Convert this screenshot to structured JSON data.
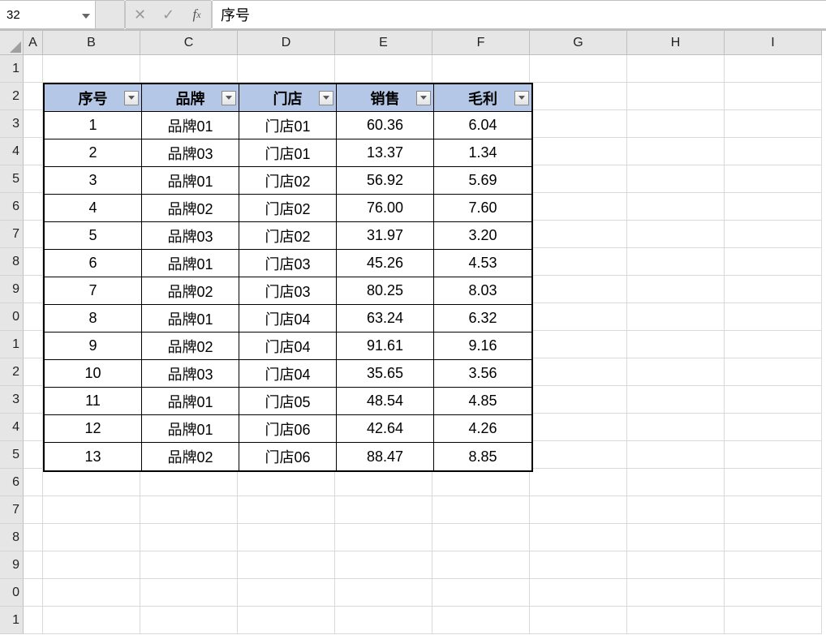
{
  "formulaBar": {
    "nameBox": "32",
    "formula": "序号"
  },
  "columnHeaders": [
    "A",
    "B",
    "C",
    "D",
    "E",
    "F",
    "G",
    "H",
    "I"
  ],
  "rowHeaders": [
    "1",
    "2",
    "3",
    "4",
    "5",
    "6",
    "7",
    "8",
    "9",
    "0",
    "1",
    "2",
    "3",
    "4",
    "5",
    "6",
    "7",
    "8",
    "9",
    "0",
    "1"
  ],
  "table": {
    "headers": [
      "序号",
      "品牌",
      "门店",
      "销售",
      "毛利"
    ],
    "rows": [
      [
        "1",
        "品牌01",
        "门店01",
        "60.36",
        "6.04"
      ],
      [
        "2",
        "品牌03",
        "门店01",
        "13.37",
        "1.34"
      ],
      [
        "3",
        "品牌01",
        "门店02",
        "56.92",
        "5.69"
      ],
      [
        "4",
        "品牌02",
        "门店02",
        "76.00",
        "7.60"
      ],
      [
        "5",
        "品牌03",
        "门店02",
        "31.97",
        "3.20"
      ],
      [
        "6",
        "品牌01",
        "门店03",
        "45.26",
        "4.53"
      ],
      [
        "7",
        "品牌02",
        "门店03",
        "80.25",
        "8.03"
      ],
      [
        "8",
        "品牌01",
        "门店04",
        "63.24",
        "6.32"
      ],
      [
        "9",
        "品牌02",
        "门店04",
        "91.61",
        "9.16"
      ],
      [
        "10",
        "品牌03",
        "门店04",
        "35.65",
        "3.56"
      ],
      [
        "11",
        "品牌01",
        "门店05",
        "48.54",
        "4.85"
      ],
      [
        "12",
        "品牌01",
        "门店06",
        "42.64",
        "4.26"
      ],
      [
        "13",
        "品牌02",
        "门店06",
        "88.47",
        "8.85"
      ]
    ]
  }
}
